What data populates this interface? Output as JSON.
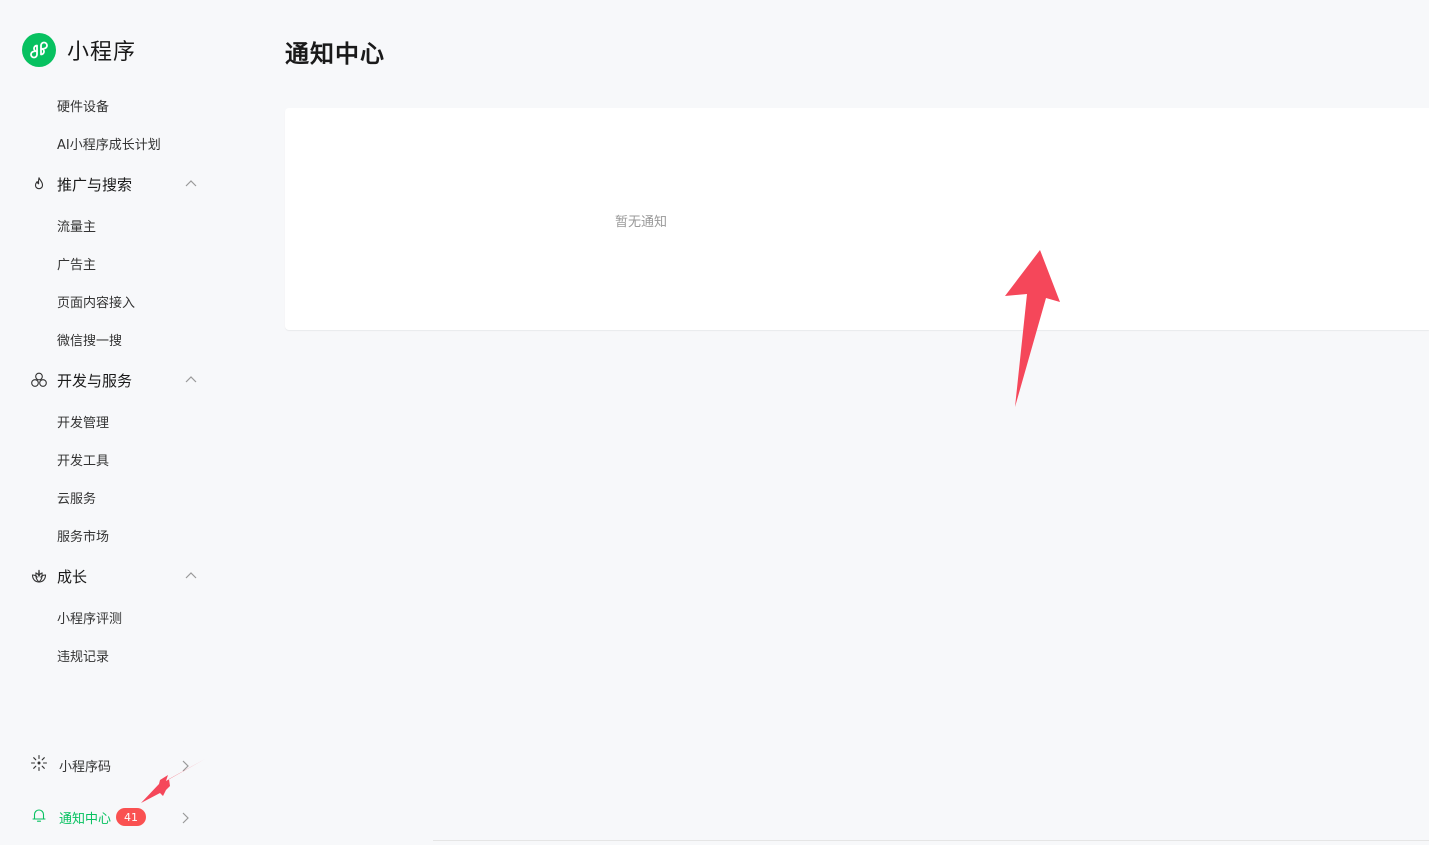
{
  "brand": {
    "name": "小程序",
    "logo_icon": "mini-program-logo-icon",
    "color": "#07c160"
  },
  "sidebar": {
    "top_items": [
      {
        "label": "硬件设备"
      },
      {
        "label": "AI小程序成长计划"
      }
    ],
    "groups": [
      {
        "label": "推广与搜索",
        "icon": "flame-icon",
        "expanded": true,
        "items": [
          {
            "label": "流量主"
          },
          {
            "label": "广告主"
          },
          {
            "label": "页面内容接入"
          },
          {
            "label": "微信搜一搜"
          }
        ]
      },
      {
        "label": "开发与服务",
        "icon": "cluster-icon",
        "expanded": true,
        "items": [
          {
            "label": "开发管理"
          },
          {
            "label": "开发工具"
          },
          {
            "label": "云服务"
          },
          {
            "label": "服务市场"
          }
        ]
      },
      {
        "label": "成长",
        "icon": "lotus-icon",
        "expanded": true,
        "items": [
          {
            "label": "小程序评测"
          },
          {
            "label": "违规记录"
          }
        ]
      }
    ],
    "bottom": {
      "qrcode": {
        "label": "小程序码",
        "icon": "qrcode-sun-icon"
      },
      "notifications": {
        "label": "通知中心",
        "icon": "bell-icon",
        "badge": "41",
        "active": true
      }
    }
  },
  "main": {
    "title": "通知中心",
    "empty_text": "暂无通知"
  },
  "colors": {
    "accent": "#07c160",
    "badge": "#fa5151",
    "annotation_arrow": "#f5475a"
  }
}
